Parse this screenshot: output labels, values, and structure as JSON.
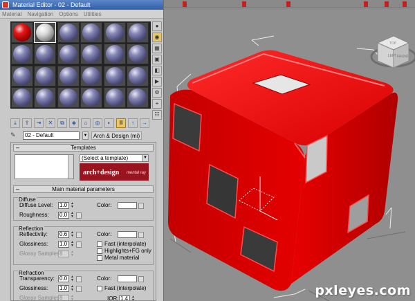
{
  "window": {
    "title": "Material Editor - 02 - Default"
  },
  "menu": [
    "Material",
    "Navigation",
    "Options",
    "Utilities"
  ],
  "material_slots": {
    "rows": 4,
    "cols": 6,
    "slot_types": [
      "red",
      "white",
      "default",
      "default",
      "default",
      "default"
    ]
  },
  "material_name": "02 - Default",
  "material_type": "Arch & Design (mi)",
  "templates": {
    "header": "Templates",
    "select_placeholder": "(Select a template)",
    "brand_main": "arch+design",
    "brand_sub": "mental ray"
  },
  "main_params": {
    "header": "Main material parameters",
    "diffuse": {
      "label": "Diffuse",
      "level_label": "Diffuse Level:",
      "level": "1.0",
      "roughness_label": "Roughness:",
      "roughness": "0.0",
      "color_label": "Color:"
    },
    "reflection": {
      "label": "Reflection",
      "reflectivity_label": "Reflectivity:",
      "reflectivity": "0.6",
      "glossiness_label": "Glossiness:",
      "glossiness": "1.0",
      "samples_label": "Glossy Samples:",
      "samples": "8",
      "color_label": "Color:",
      "fast_interp": "Fast (interpolate)",
      "highlights_fg": "Highlights+FG only",
      "metal": "Metal material"
    },
    "refraction": {
      "label": "Refraction",
      "transparency_label": "Transparency:",
      "transparency": "0.0",
      "glossiness_label": "Glossiness:",
      "glossiness": "1.0",
      "samples_label": "Glossy Samples:",
      "samples": "8",
      "color_label": "Color:",
      "fast_interp": "Fast (interpolate)",
      "ior_label": "IOR:",
      "ior": "1.4"
    }
  },
  "viewcube": {
    "face_top": "TOP",
    "face_left": "LEFT",
    "face_front": "FRONT"
  },
  "watermark": "pxleyes.com",
  "colors": {
    "cube_red": "#e00000",
    "viewport_bg": "#8f8f8f",
    "brand_red": "#9a1420"
  }
}
